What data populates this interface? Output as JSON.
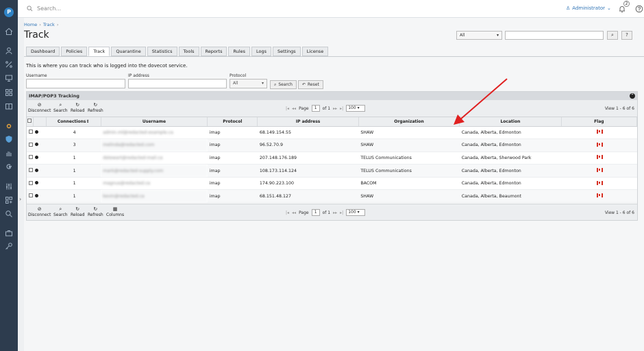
{
  "topbar": {
    "search_placeholder": "Search...",
    "user_name": "Administrator",
    "notif_count": "2"
  },
  "breadcrumb": {
    "home": "Home",
    "current": "Track"
  },
  "page_title": "Track",
  "global_filter": {
    "selected": "All"
  },
  "tabs": [
    "Dashboard",
    "Policies",
    "Track",
    "Quarantine",
    "Statistics",
    "Tools",
    "Reports",
    "Rules",
    "Logs",
    "Settings",
    "License"
  ],
  "active_tab": "Track",
  "description": "This is where you can track who is logged into the dovecot service.",
  "filters": {
    "username_label": "Username",
    "ip_label": "IP address",
    "protocol_label": "Protocol",
    "protocol_value": "All",
    "search_label": "Search",
    "reset_label": "Reset"
  },
  "grid": {
    "title": "IMAP/POP3 Tracking",
    "toolbar": {
      "disconnect": "Disconnect",
      "search": "Search",
      "reload": "Reload",
      "refresh": "Refresh",
      "columns": "Columns"
    },
    "pager": {
      "page_label": "Page",
      "page": "1",
      "of": "of 1",
      "per_page": "100"
    },
    "view_info": "View 1 - 6 of 6",
    "columns": [
      "Connections",
      "Username",
      "Protocol",
      "IP address",
      "Organization",
      "Location",
      "Flag"
    ],
    "sort_indicator": "⇕",
    "rows": [
      {
        "connections": "4",
        "username": "admin.ml@redacted-example.ca",
        "protocol": "imap",
        "ip": "68.149.154.55",
        "org": "SHAW",
        "location": "Canada, Alberta, Edmonton"
      },
      {
        "connections": "3",
        "username": "melinda@redacted.com",
        "protocol": "imap",
        "ip": "96.52.70.9",
        "org": "SHAW",
        "location": "Canada, Alberta, Edmonton"
      },
      {
        "connections": "1",
        "username": "dstewart@redacted-mail.ca",
        "protocol": "imap",
        "ip": "207.148.176.189",
        "org": "TELUS Communications",
        "location": "Canada, Alberta, Sherwood Park"
      },
      {
        "connections": "1",
        "username": "mark@redacted-supply.com",
        "protocol": "imap",
        "ip": "108.173.114.124",
        "org": "TELUS Communications",
        "location": "Canada, Alberta, Edmonton"
      },
      {
        "connections": "1",
        "username": "magnus@redacted.ca",
        "protocol": "imap",
        "ip": "174.90.223.100",
        "org": "BACOM",
        "location": "Canada, Alberta, Edmonton"
      },
      {
        "connections": "1",
        "username": "kevin@redacted.ca",
        "protocol": "imap",
        "ip": "68.151.48.127",
        "org": "SHAW",
        "location": "Canada, Alberta, Beaumont"
      }
    ]
  },
  "colors": {
    "sidebar": "#2d3c4e",
    "accent": "#2f73b5",
    "arrow": "#e02020",
    "flag_red": "#d52b1e"
  }
}
